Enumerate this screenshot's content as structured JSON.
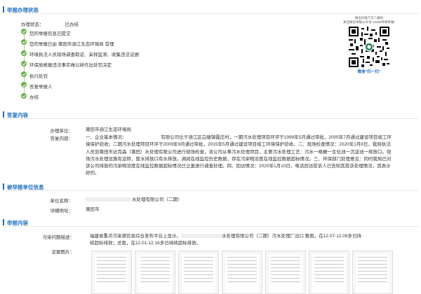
{
  "sections": {
    "progress": "举报办理状态",
    "reply": "答复内容",
    "target": "被举报单位信息",
    "report": "举报内容"
  },
  "status": {
    "label": "办理状态：",
    "value": "已办结"
  },
  "steps": [
    "您的举报信息已提交",
    "您的举报已由 莆田市涵江生态环境局 受理",
    "环境执法人员现场调查取证、采样监测、收集违法证据",
    "环保局根据违法事实做以拼作出处罚决定",
    "执行处罚",
    "答复举报人",
    "办结"
  ],
  "qr": {
    "caption_1": "微信扫描下方二维码",
    "caption_2": "关注微信举报公众号“12369环保举报”",
    "footer": "微信“扫一扫”"
  },
  "reply": {
    "unit_label": "办理单位：",
    "unit_value": "莆田市涵江生态环境局",
    "content_label": "答复内容：",
    "content_value": "一、企业基本情况：　　　　　　　　有限公司位于涵江区白塘镇霞庄村，一期污水处理项目环评于1999年5月通过审批，2005年7月通过建设项目竣工环境保护验收；二期污水处理项目环评于2009年9月通过审批，2015年5月通过建设项目竣工环境保护验收。二、现场检查情况：2020年1月8日，我局执法人员到莆田市达克森（莆田）水处理有限公司进行现场检查，该公司从事污水处理项目，主要污水处理工艺：污水一格栅一生化池一沉淀池一排放口。现场污水处理设施有运转，废水排放口有水排放。调阅在线监控历史数据，存在污染物浓度在线监控数据超标情况。三、环保部门处理意见：同时我局已对该公司排放的污染物浓度在线监控数据超标情况已立案进行调查处理。四、回访情况：2020年1月10日，电话回访投诉人已告知其投诉处理情况，其表示好的。"
  },
  "target": {
    "name_label": "单位名称：",
    "name_value": "水处理有限公司（二期）",
    "address_label": "详细地址：",
    "address_value": "莆田市"
  },
  "report": {
    "desc_label": "污染问题描述：",
    "desc_line1_a": "福建省重点污染源信息综合发布平台上显示，",
    "desc_line1_b": "水处理有限公司（二期）污水处理厂出口 氨氮，在12.07-12.09多日持",
    "desc_line2": "续超标排放；总氮，在12.01-12.16多日持续超标排放。",
    "evidence_label": "证据图片："
  },
  "colors": {
    "accent": "#1b6fc2",
    "step_done": "#6ab04c"
  }
}
